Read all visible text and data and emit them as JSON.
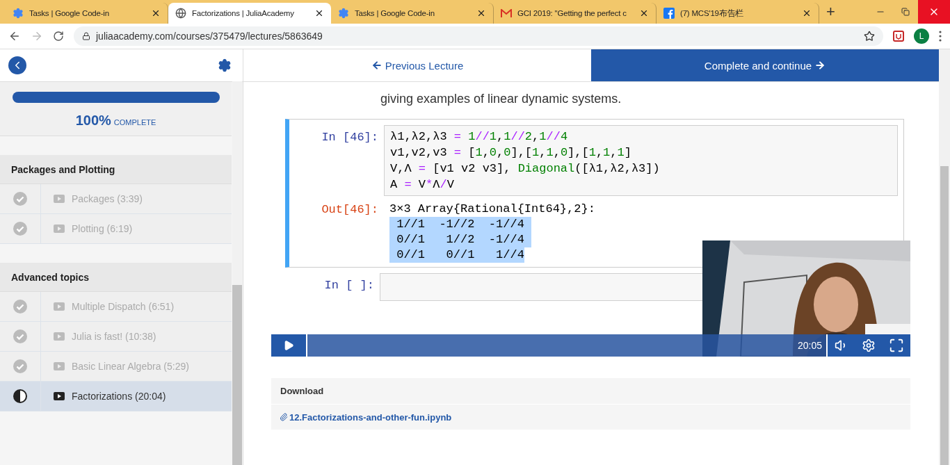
{
  "browser": {
    "tabs": [
      {
        "title": "Tasks | Google Code-in",
        "kind": "gear",
        "selected": false
      },
      {
        "title": "Factorizations | JuliaAcademy",
        "kind": "globe",
        "selected": true
      },
      {
        "title": "Tasks | Google Code-in",
        "kind": "gear",
        "selected": false
      },
      {
        "title": "GCI 2019: \"Getting the perfect c",
        "kind": "mail",
        "selected": false
      },
      {
        "title": "(7) MCS'19布告栏",
        "kind": "facebook",
        "selected": false
      }
    ],
    "new_tab": "+",
    "url": "juliaacademy.com/courses/375479/lectures/5863649",
    "avatar": "L"
  },
  "sidebar": {
    "progress": {
      "level": 1,
      "percent": "100%",
      "label": "COMPLETE"
    },
    "sections": [
      {
        "title": "Packages and Plotting",
        "lessons": [
          {
            "title": "Packages (3:39)",
            "kind": "done",
            "selected": false
          },
          {
            "title": "Plotting (6:19)",
            "kind": "done",
            "selected": false
          }
        ]
      },
      {
        "title": "Advanced topics",
        "lessons": [
          {
            "title": "Multiple Dispatch (6:51)",
            "kind": "done",
            "selected": false
          },
          {
            "title": "Julia is fast! (10:38)",
            "kind": "done",
            "selected": false
          },
          {
            "title": "Basic Linear Algebra (5:29)",
            "kind": "done",
            "selected": false
          },
          {
            "title": "Factorizations (20:04)",
            "kind": "partial",
            "selected": true
          }
        ]
      }
    ]
  },
  "nav": {
    "previous": "Previous Lecture",
    "next": "Complete and continue"
  },
  "lecture": {
    "text": "giving examples of linear dynamic systems.",
    "cells": [
      {
        "prompt": "In [46]:",
        "lines": [
          [
            {
              "t": "λ1,λ2,λ3 ",
              "kind": "plain"
            },
            {
              "t": "= ",
              "kind": "op"
            },
            {
              "t": "1",
              "kind": "num"
            },
            {
              "t": "//",
              "kind": "op"
            },
            {
              "t": "1",
              "kind": "num"
            },
            {
              "t": ",",
              "kind": "plain"
            },
            {
              "t": "1",
              "kind": "num"
            },
            {
              "t": "//",
              "kind": "op"
            },
            {
              "t": "2",
              "kind": "num"
            },
            {
              "t": ",",
              "kind": "plain"
            },
            {
              "t": "1",
              "kind": "num"
            },
            {
              "t": "//",
              "kind": "op"
            },
            {
              "t": "4",
              "kind": "num"
            }
          ],
          [
            {
              "t": "v1,v2,v3 ",
              "kind": "plain"
            },
            {
              "t": "=",
              "kind": "op"
            },
            {
              "t": " [",
              "kind": "plain"
            },
            {
              "t": "1",
              "kind": "num"
            },
            {
              "t": ",",
              "kind": "plain"
            },
            {
              "t": "0",
              "kind": "num"
            },
            {
              "t": ",",
              "kind": "plain"
            },
            {
              "t": "0",
              "kind": "num"
            },
            {
              "t": "],[",
              "kind": "plain"
            },
            {
              "t": "1",
              "kind": "num"
            },
            {
              "t": ",",
              "kind": "plain"
            },
            {
              "t": "1",
              "kind": "num"
            },
            {
              "t": ",",
              "kind": "plain"
            },
            {
              "t": "0",
              "kind": "num"
            },
            {
              "t": "],[",
              "kind": "plain"
            },
            {
              "t": "1",
              "kind": "num"
            },
            {
              "t": ",",
              "kind": "plain"
            },
            {
              "t": "1",
              "kind": "num"
            },
            {
              "t": ",",
              "kind": "plain"
            },
            {
              "t": "1",
              "kind": "num"
            },
            {
              "t": "]",
              "kind": "plain"
            }
          ],
          [
            {
              "t": "V,Λ ",
              "kind": "plain"
            },
            {
              "t": "=",
              "kind": "op"
            },
            {
              "t": " [v1 v2 v3], ",
              "kind": "plain"
            },
            {
              "t": "Diagonal",
              "kind": "fn"
            },
            {
              "t": "([λ1,λ2,λ3])",
              "kind": "plain"
            }
          ],
          [
            {
              "t": "A ",
              "kind": "plain"
            },
            {
              "t": "=",
              "kind": "op"
            },
            {
              "t": " V",
              "kind": "plain"
            },
            {
              "t": "*",
              "kind": "op"
            },
            {
              "t": "Λ",
              "kind": "plain"
            },
            {
              "t": "/",
              "kind": "op"
            },
            {
              "t": "V",
              "kind": "plain"
            }
          ]
        ],
        "out_prompt": "Out[46]:",
        "out_head": "3×3 Array{Rational{Int64},2}:",
        "out_selected": true,
        "out_rows": [
          " 1//1  -1//2  -1//4 ",
          " 0//1   1//2  -1//4 ",
          " 0//1   0//1   1//4"
        ]
      },
      {
        "prompt": "In [ ]:"
      }
    ],
    "video": {
      "time": "20:05"
    },
    "download": {
      "title": "Download",
      "file": "12.Factorizations-and-other-fun.ipynb"
    }
  }
}
